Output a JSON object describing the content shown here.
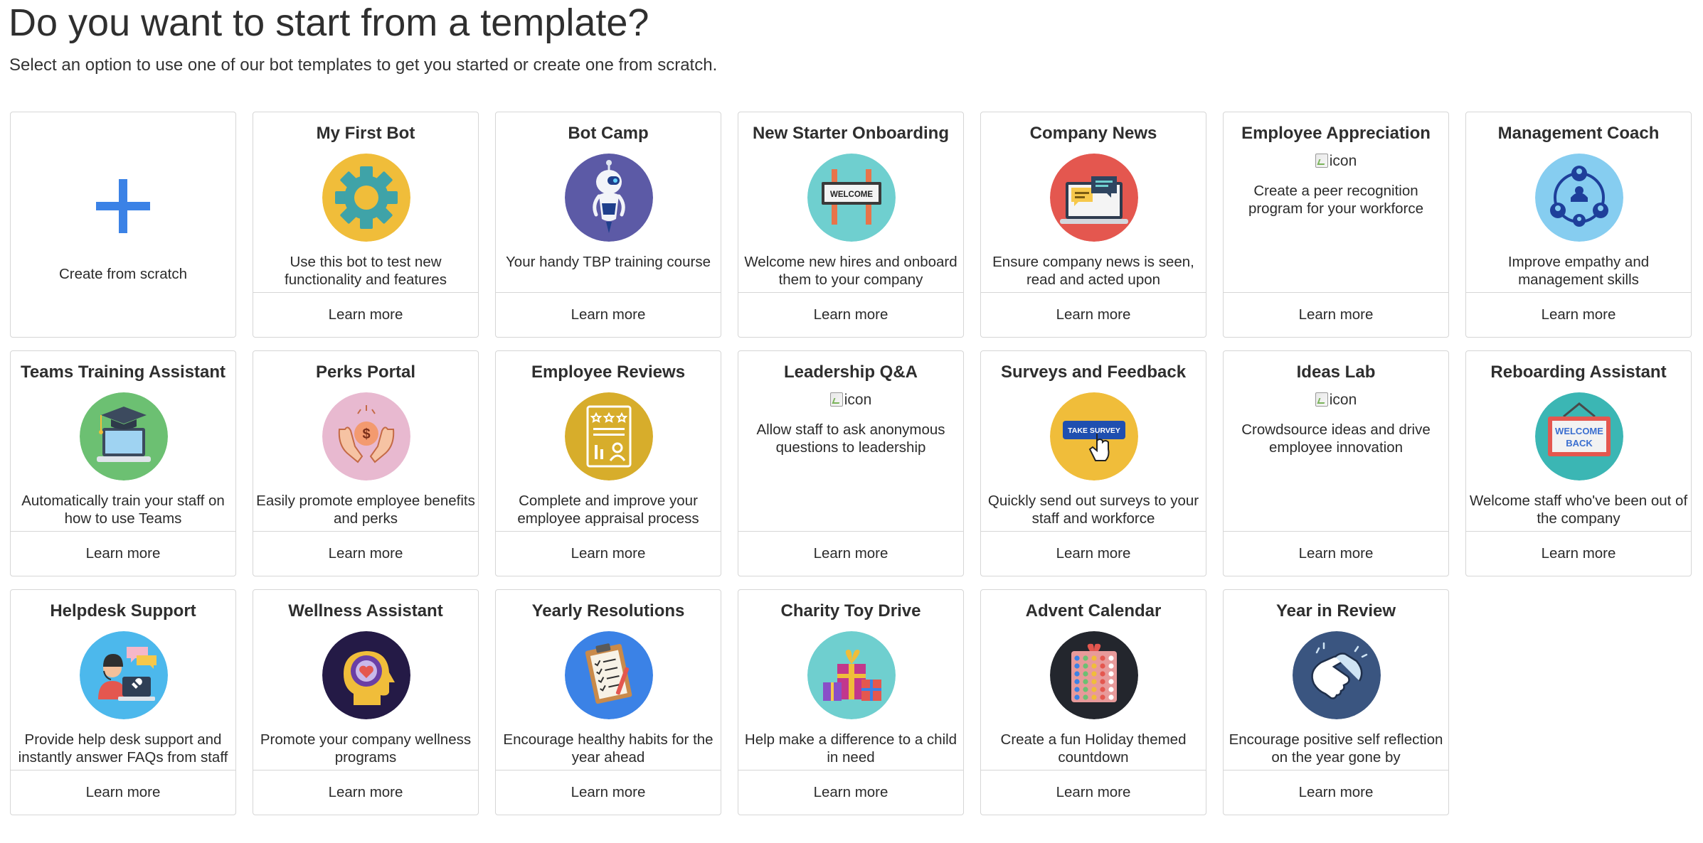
{
  "header": {
    "title": "Do you want to start from a template?",
    "subtitle": "Select an option to use one of our bot templates to get you started or create one from scratch."
  },
  "scratch": {
    "label": "Create from scratch",
    "plus_color": "#3b82e6"
  },
  "cards": [
    {
      "title": "My First Bot",
      "description": "Use this bot to test new functionality and features",
      "learn_more": "Learn more",
      "icon": "gear-icon",
      "icon_bg": "#f0bd3a"
    },
    {
      "title": "Bot Camp",
      "description": "Your handy TBP training course",
      "learn_more": "Learn more",
      "icon": "robot-icon",
      "icon_bg": "#5c5aa6"
    },
    {
      "title": "New Starter Onboarding",
      "description": "Welcome new hires and onboard them to your company",
      "learn_more": "Learn more",
      "icon": "welcome-sign-icon",
      "icon_bg": "#6fcfcf",
      "sign_text": "WELCOME"
    },
    {
      "title": "Company News",
      "description": "Ensure company news is seen, read and acted upon",
      "learn_more": "Learn more",
      "icon": "news-laptop-icon",
      "icon_bg": "#e4574f"
    },
    {
      "title": "Employee Appreciation",
      "description": "Create a peer recognition program for your workforce",
      "learn_more": "Learn more",
      "icon": "broken-image-icon",
      "alt": "icon"
    },
    {
      "title": "Management Coach",
      "description": "Improve empathy and management skills",
      "learn_more": "Learn more",
      "icon": "team-network-icon",
      "icon_bg": "#86cdf0"
    },
    {
      "title": "Teams Training Assistant",
      "description": "Automatically train your staff on how to use Teams",
      "learn_more": "Learn more",
      "icon": "graduation-laptop-icon",
      "icon_bg": "#6cc072"
    },
    {
      "title": "Perks Portal",
      "description": "Easily promote employee benefits and perks",
      "learn_more": "Learn more",
      "icon": "hands-dollar-icon",
      "icon_bg": "#e8b9d0"
    },
    {
      "title": "Employee Reviews",
      "description": "Complete and improve your employee appraisal process",
      "learn_more": "Learn more",
      "icon": "appraisal-document-icon",
      "icon_bg": "#d7ad2b"
    },
    {
      "title": "Leadership Q&A",
      "description": "Allow staff to ask anonymous questions to leadership",
      "learn_more": "Learn more",
      "icon": "broken-image-icon",
      "alt": "icon"
    },
    {
      "title": "Surveys and Feedback",
      "description": "Quickly send out surveys to your staff and workforce",
      "learn_more": "Learn more",
      "icon": "take-survey-icon",
      "icon_bg": "#f0bd3a",
      "button_text": "TAKE SURVEY"
    },
    {
      "title": "Ideas Lab",
      "description": "Crowdsource ideas and drive employee innovation",
      "learn_more": "Learn more",
      "icon": "broken-image-icon",
      "alt": "icon"
    },
    {
      "title": "Reboarding Assistant",
      "description": "Welcome staff who've been out of the company",
      "learn_more": "Learn more",
      "icon": "welcome-back-sign-icon",
      "icon_bg": "#3bb6b4",
      "sign_line1": "WELCOME",
      "sign_line2": "BACK"
    },
    {
      "title": "Helpdesk Support",
      "description": "Provide help desk support and instantly answer FAQs from staff",
      "learn_more": "Learn more",
      "icon": "helpdesk-agent-icon",
      "icon_bg": "#4cb8ec"
    },
    {
      "title": "Wellness Assistant",
      "description": "Promote your company wellness programs",
      "learn_more": "Learn more",
      "icon": "head-heart-icon",
      "icon_bg": "#241a46"
    },
    {
      "title": "Yearly Resolutions",
      "description": "Encourage healthy habits for the year ahead",
      "learn_more": "Learn more",
      "icon": "clipboard-checklist-icon",
      "icon_bg": "#3b82e6"
    },
    {
      "title": "Charity Toy Drive",
      "description": "Help make a difference to a child in need",
      "learn_more": "Learn more",
      "icon": "gift-boxes-icon",
      "icon_bg": "#6fcfcf"
    },
    {
      "title": "Advent Calendar",
      "description": "Create a fun Holiday themed countdown",
      "learn_more": "Learn more",
      "icon": "advent-calendar-icon",
      "icon_bg": "#23262d"
    },
    {
      "title": "Year in Review",
      "description": "Encourage positive self reflection on the year gone by",
      "learn_more": "Learn more",
      "icon": "handshake-icon",
      "icon_bg": "#3a5580"
    }
  ]
}
